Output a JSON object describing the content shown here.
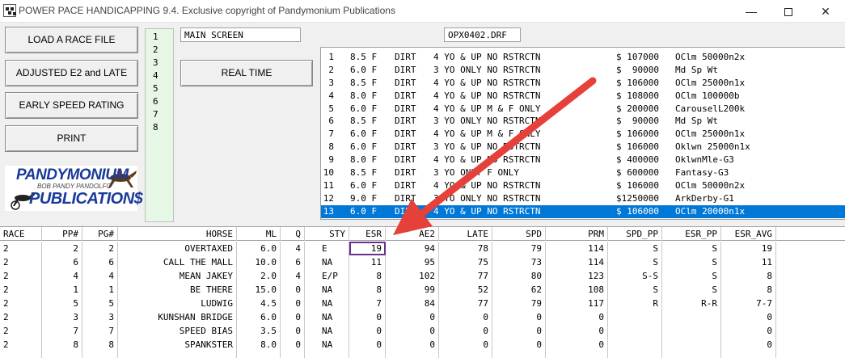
{
  "window": {
    "title": "POWER PACE HANDICAPPING 9.4.  Exclusive copyright of Pandymonium Publications",
    "min_glyph": "—",
    "close_glyph": "✕"
  },
  "buttons": {
    "load": "LOAD A RACE FILE",
    "adjusted": "ADJUSTED E2 and LATE",
    "early_speed": "EARLY SPEED RATING",
    "print": "PRINT",
    "real_time": "REAL TIME"
  },
  "main_screen": "MAIN SCREEN",
  "file_name": "OPX0402.DRF",
  "logo": {
    "top": "PANDYMONIUM",
    "mid": "BOB PANDY PANDOLFO",
    "bottom": "PUBLICATION$"
  },
  "race_numbers": [
    "1",
    "2",
    "3",
    "4",
    "5",
    "6",
    "7",
    "8"
  ],
  "races": [
    {
      "num": "1",
      "dist": "8.5 F",
      "surf": "DIRT",
      "cond": "4 YO & UP NO RSTRCTN",
      "purse": "$ 107000",
      "type": "OClm 50000n2x"
    },
    {
      "num": "2",
      "dist": "6.0 F",
      "surf": "DIRT",
      "cond": "3 YO ONLY NO RSTRCTN",
      "purse": "$  90000",
      "type": "Md Sp Wt"
    },
    {
      "num": "3",
      "dist": "8.5 F",
      "surf": "DIRT",
      "cond": "4 YO & UP NO RSTRCTN",
      "purse": "$ 106000",
      "type": "OClm 25000n1x"
    },
    {
      "num": "4",
      "dist": "8.0 F",
      "surf": "DIRT",
      "cond": "4 YO & UP NO RSTRCTN",
      "purse": "$ 108000",
      "type": "OClm 100000b"
    },
    {
      "num": "5",
      "dist": "6.0 F",
      "surf": "DIRT",
      "cond": "4 YO & UP M & F ONLY",
      "purse": "$ 200000",
      "type": "CarouselL200k"
    },
    {
      "num": "6",
      "dist": "8.5 F",
      "surf": "DIRT",
      "cond": "3 YO ONLY NO RSTRCTN",
      "purse": "$  90000",
      "type": "Md Sp Wt"
    },
    {
      "num": "7",
      "dist": "6.0 F",
      "surf": "DIRT",
      "cond": "4 YO & UP M & F ONLY",
      "purse": "$ 106000",
      "type": "OClm 25000n1x"
    },
    {
      "num": "8",
      "dist": "6.0 F",
      "surf": "DIRT",
      "cond": "3 YO & UP NO RSTRCTN",
      "purse": "$ 106000",
      "type": "Oklwn 25000n1x"
    },
    {
      "num": "9",
      "dist": "8.0 F",
      "surf": "DIRT",
      "cond": "4 YO & UP NO RSTRCTN",
      "purse": "$ 400000",
      "type": "OklwnMle-G3"
    },
    {
      "num": "10",
      "dist": "8.5 F",
      "surf": "DIRT",
      "cond": "3 YO ONLY F ONLY",
      "purse": "$ 600000",
      "type": "Fantasy-G3"
    },
    {
      "num": "11",
      "dist": "6.0 F",
      "surf": "DIRT",
      "cond": "4 YO & UP NO RSTRCTN",
      "purse": "$ 106000",
      "type": "OClm 50000n2x"
    },
    {
      "num": "12",
      "dist": "9.0 F",
      "surf": "DIRT",
      "cond": "3 YO ONLY NO RSTRCTN",
      "purse": "$1250000",
      "type": "ArkDerby-G1"
    },
    {
      "num": "13",
      "dist": "6.0 F",
      "surf": "DIRT",
      "cond": "4 YO & UP NO RSTRCTN",
      "purse": "$ 106000",
      "type": "OClm 20000n1x"
    }
  ],
  "grid": {
    "columns": [
      "RACE",
      "PP#",
      "PG#",
      "HORSE",
      "ML",
      "Q",
      "STY",
      "ESR",
      "AE2",
      "LATE",
      "SPD",
      "PRM",
      "SPD_PP",
      "ESR_PP",
      "ESR_AVG"
    ],
    "rows": [
      [
        "2",
        "2",
        "2",
        "OVERTAXED",
        "6.0",
        "4",
        "E",
        "19",
        "94",
        "78",
        "79",
        "114",
        "S",
        "S",
        "19"
      ],
      [
        "2",
        "6",
        "6",
        "CALL THE MALL",
        "10.0",
        "6",
        "NA",
        "11",
        "95",
        "75",
        "73",
        "114",
        "S",
        "S",
        "11"
      ],
      [
        "2",
        "4",
        "4",
        "MEAN JAKEY",
        "2.0",
        "4",
        "E/P",
        "8",
        "102",
        "77",
        "80",
        "123",
        "S-S",
        "S",
        "8"
      ],
      [
        "2",
        "1",
        "1",
        "BE THERE",
        "15.0",
        "0",
        "NA",
        "8",
        "99",
        "52",
        "62",
        "108",
        "S",
        "S",
        "8"
      ],
      [
        "2",
        "5",
        "5",
        "LUDWIG",
        "4.5",
        "0",
        "NA",
        "7",
        "84",
        "77",
        "79",
        "117",
        "R",
        "R-R",
        "7-7"
      ],
      [
        "2",
        "3",
        "3",
        "KUNSHAN BRIDGE",
        "6.0",
        "0",
        "NA",
        "0",
        "0",
        "0",
        "0",
        "0",
        "",
        "",
        "0"
      ],
      [
        "2",
        "7",
        "7",
        "SPEED BIAS",
        "3.5",
        "0",
        "NA",
        "0",
        "0",
        "0",
        "0",
        "0",
        "",
        "",
        "0"
      ],
      [
        "2",
        "8",
        "8",
        "SPANKSTER",
        "8.0",
        "0",
        "NA",
        "0",
        "0",
        "0",
        "0",
        "0",
        "",
        "",
        "0"
      ]
    ]
  },
  "colors": {
    "selection": "#0078d7",
    "arrow": "#e5413a",
    "highlight_box": "#6a2f8f",
    "race_list_bg": "#e6f7e6"
  }
}
